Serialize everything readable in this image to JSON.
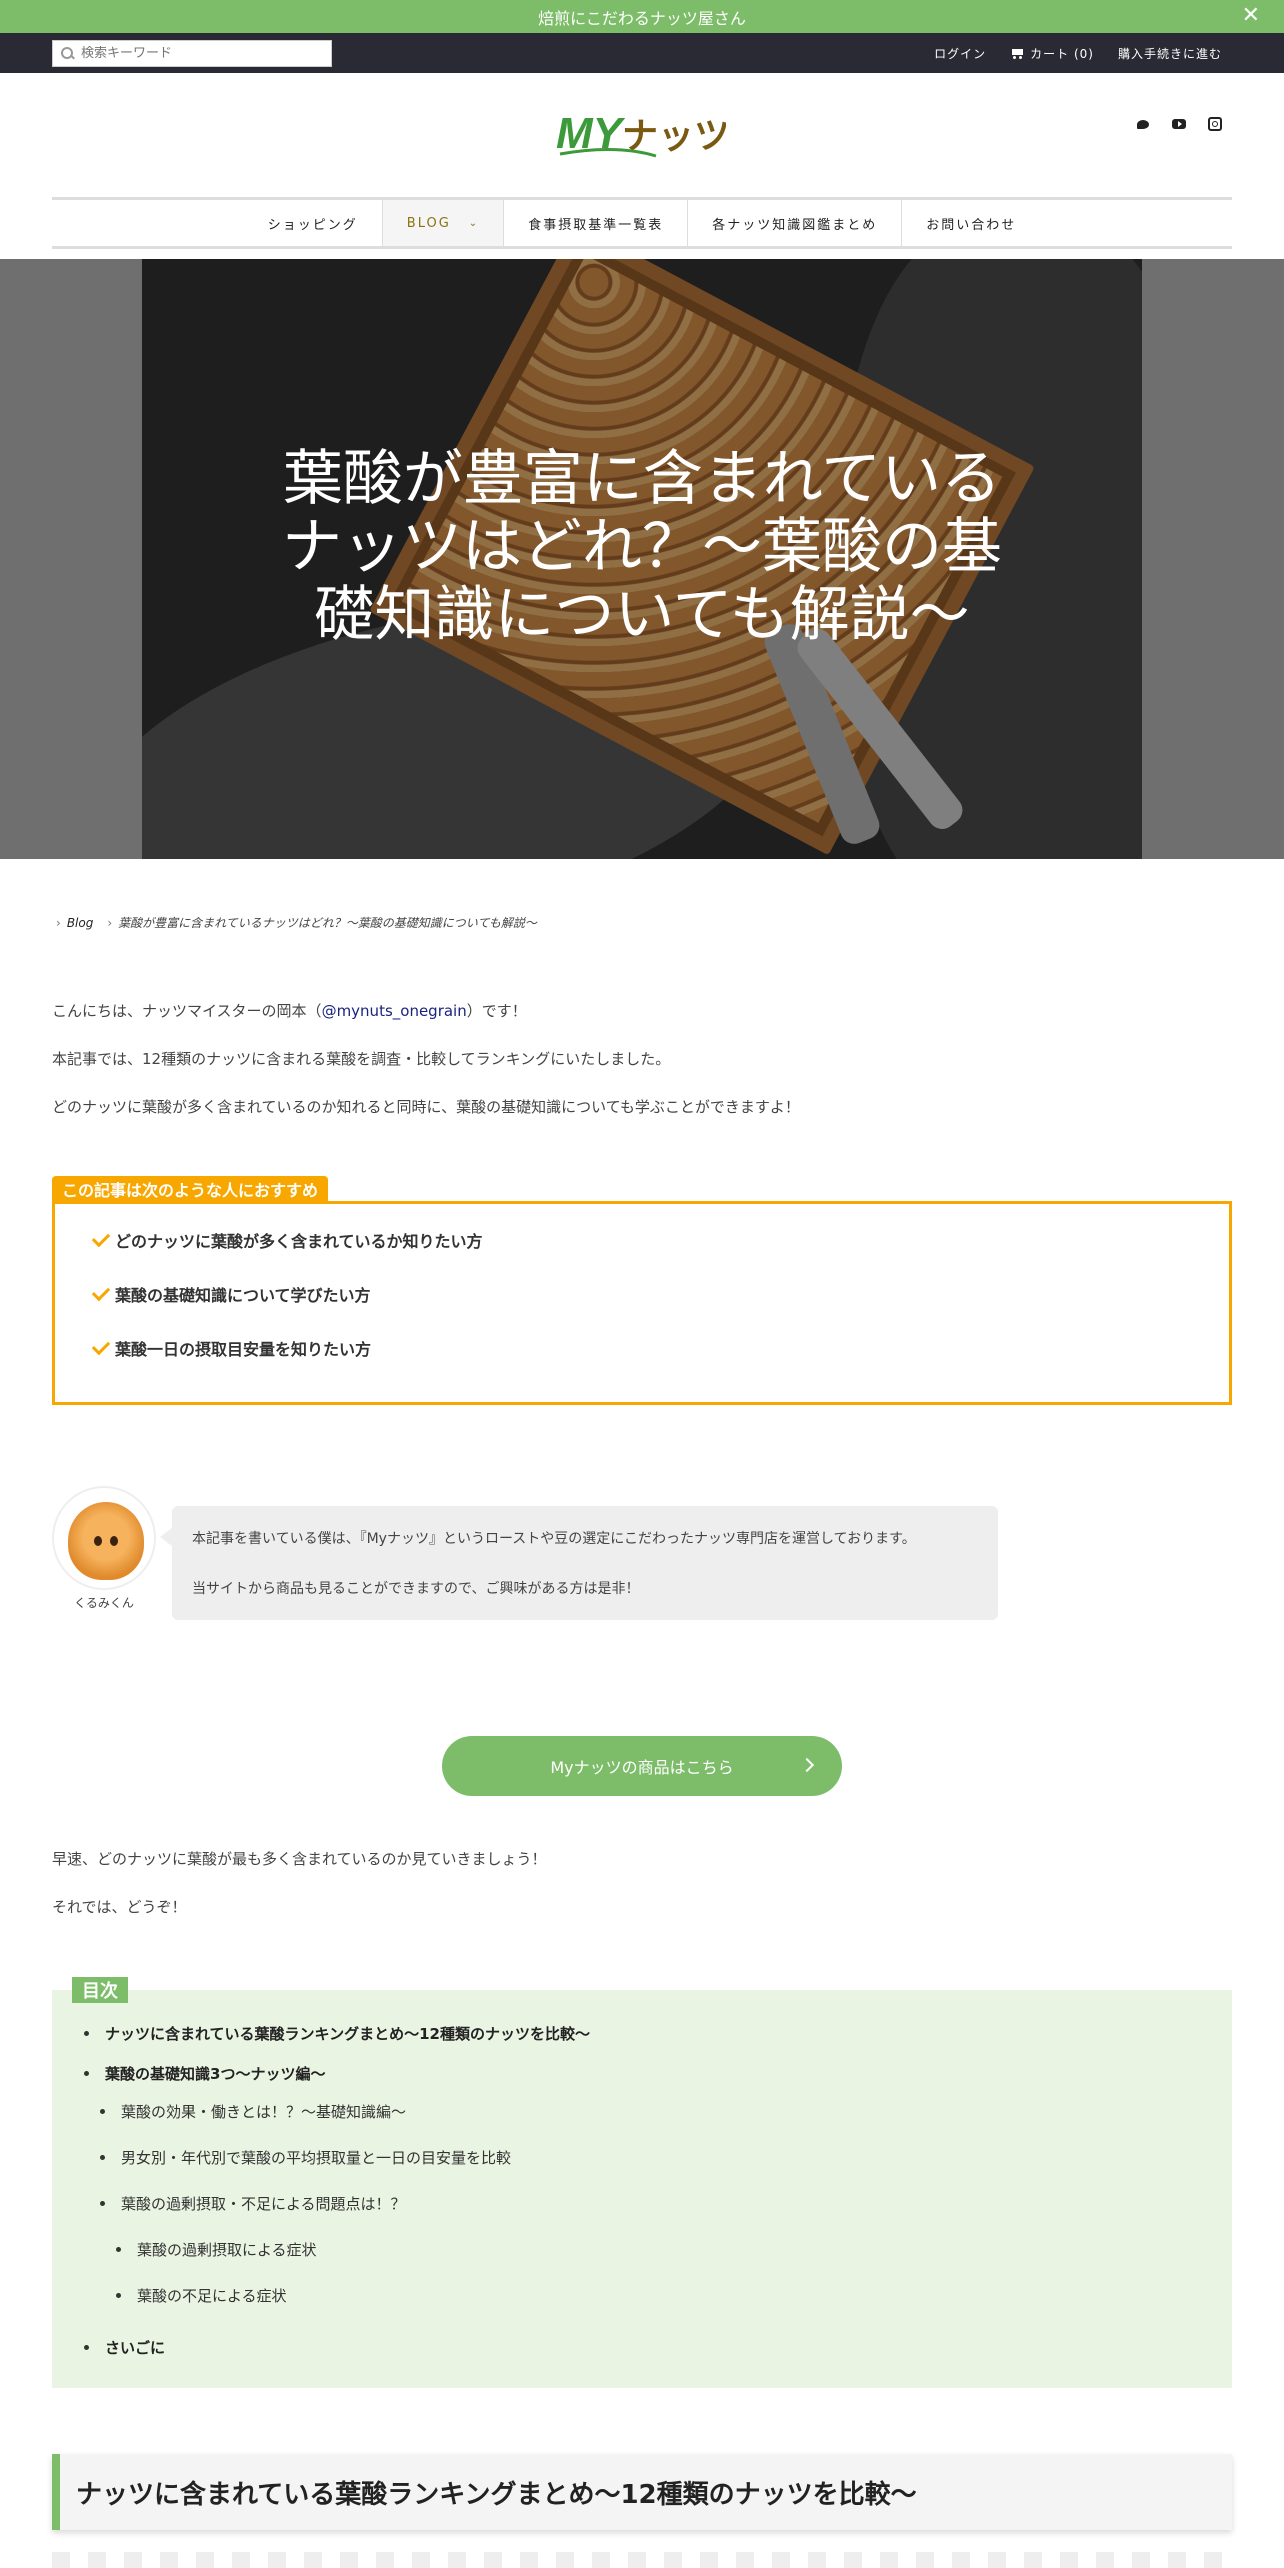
{
  "announcement": {
    "text": "焙煎にこだわるナッツ屋さん",
    "close": "✕"
  },
  "topbar": {
    "search_placeholder": "検索キーワード",
    "login": "ログイン",
    "cart": "カート (0)",
    "checkout": "購入手続きに進む"
  },
  "header": {
    "logo_text": "MYナッツ"
  },
  "nav": {
    "items": [
      {
        "label": "ショッピング"
      },
      {
        "label": "BLOG"
      },
      {
        "label": "食事摂取基準一覧表"
      },
      {
        "label": "各ナッツ知識図鑑まとめ"
      },
      {
        "label": "お問い合わせ"
      }
    ]
  },
  "hero": {
    "title": "葉酸が豊富に含まれているナッツはどれ？〜葉酸の基礎知識についても解説〜"
  },
  "breadcrumb": {
    "blog": "Blog",
    "current": "葉酸が豊富に含まれているナッツはどれ？〜葉酸の基礎知識についても解説〜"
  },
  "intro": {
    "p1_before": "こんにちは、ナッツマイスターの岡本（",
    "p1_handle": "@mynuts_onegrain",
    "p1_after": "）です！",
    "p2": "本記事では、12種類のナッツに含まれる葉酸を調査・比較してランキングにいたしました。",
    "p3": "どのナッツに葉酸が多く含まれているのか知れると同時に、葉酸の基礎知識についても学ぶことができますよ！"
  },
  "recommend": {
    "label": "この記事は次のような人におすすめ",
    "items": [
      "どのナッツに葉酸が多く含まれているか知りたい方",
      "葉酸の基礎知識について学びたい方",
      "葉酸一日の摂取目安量を知りたい方"
    ]
  },
  "speech": {
    "name": "くるみくん",
    "line1": "本記事を書いている僕は、『Myナッツ』というローストや豆の選定にこだわったナッツ専門店を運営しております。",
    "line2": "当サイトから商品も見ることができますので、ご興味がある方は是非！"
  },
  "cta": {
    "label": "Myナッツの商品はこちら"
  },
  "lead": {
    "p1": "早速、どのナッツに葉酸が最も多く含まれているのか見ていきましょう！",
    "p2": "それでは、どうぞ！"
  },
  "toc": {
    "label": "目次",
    "items": [
      "ナッツに含まれている葉酸ランキングまとめ〜12種類のナッツを比較〜",
      "葉酸の基礎知識3つ〜ナッツ編〜",
      "葉酸の効果・働きとは！？〜基礎知識編〜",
      "男女別・年代別で葉酸の平均摂取量と一日の目安量を比較",
      "葉酸の過剰摂取・不足による問題点は！？",
      "葉酸の過剰摂取による症状",
      "葉酸の不足による症状",
      "さいごに"
    ]
  },
  "section": {
    "heading": "ナッツに含まれている葉酸ランキングまとめ〜12種類のナッツを比較〜"
  },
  "colors": {
    "brand_green": "#7dbd6a",
    "accent_orange": "#f7a700",
    "topbar": "#2a2a35",
    "nav_active": "#8b7310"
  }
}
